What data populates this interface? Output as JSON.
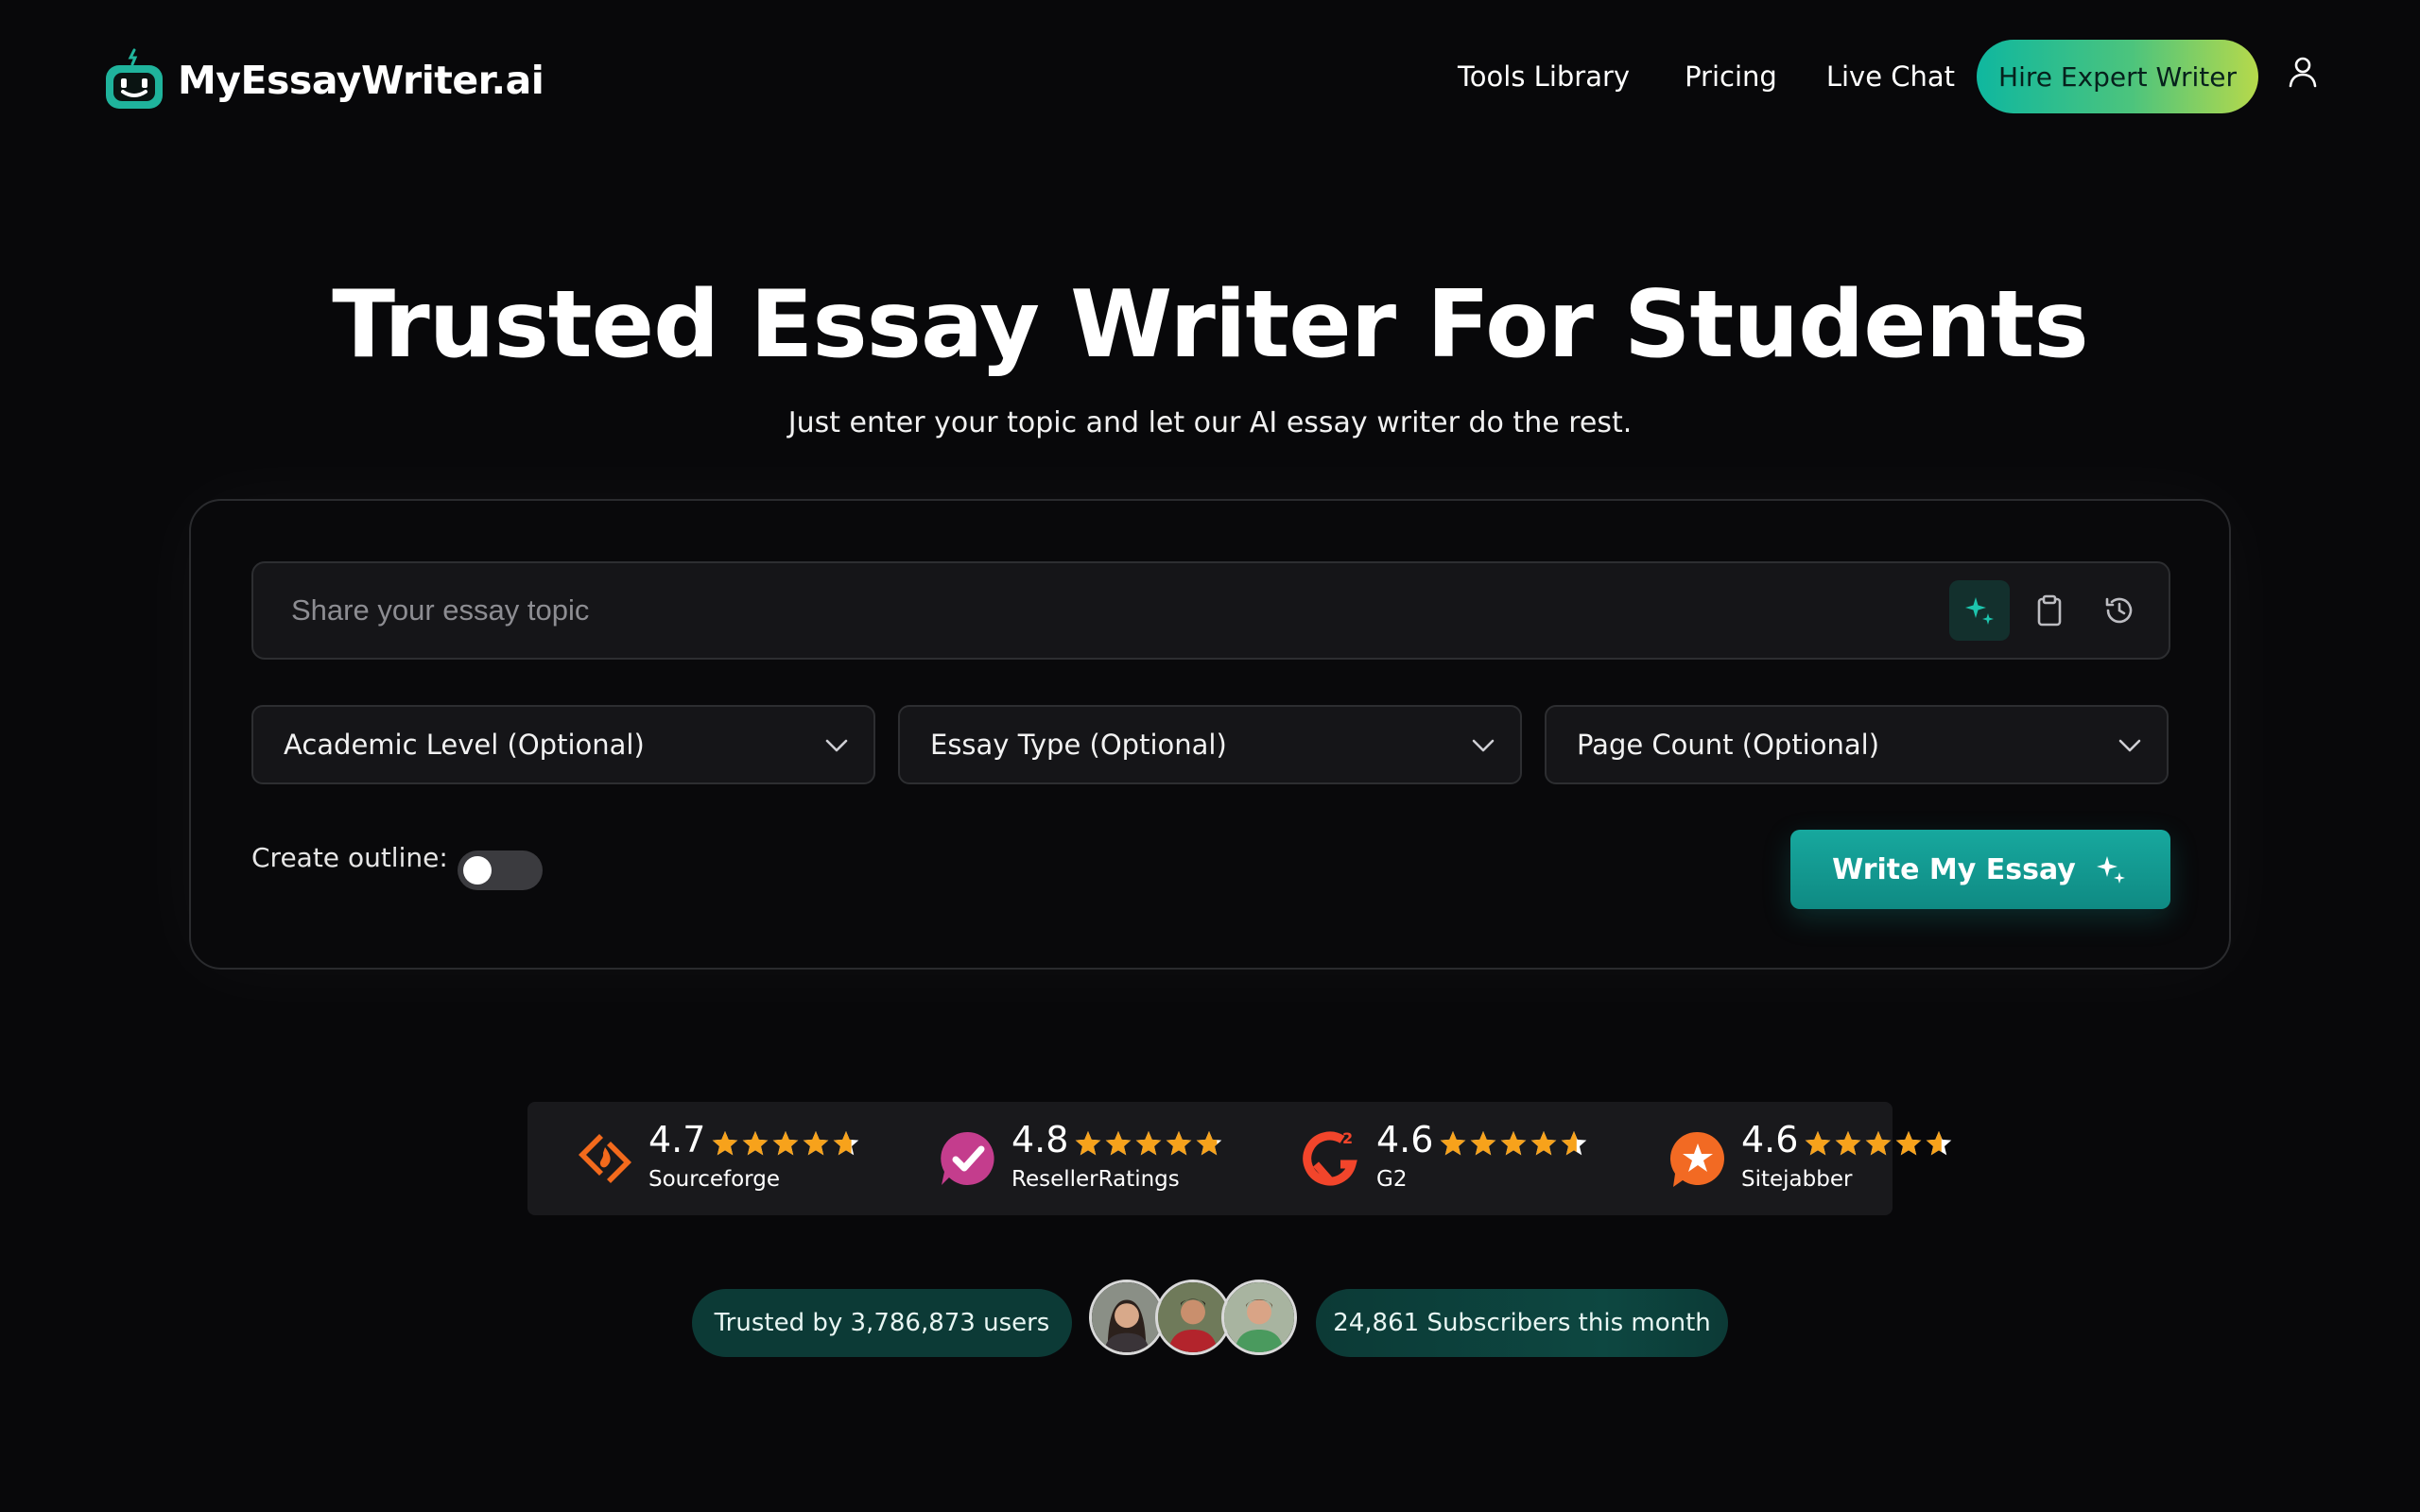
{
  "header": {
    "brand": "MyEssayWriter.ai",
    "nav": [
      "Tools Library",
      "Pricing",
      "Live Chat"
    ],
    "cta": "Hire Expert Writer"
  },
  "hero": {
    "title": "Trusted Essay Writer For Students",
    "subtitle": "Just enter your topic and let our AI essay writer do the rest."
  },
  "form": {
    "topic_placeholder": "Share your essay topic",
    "topic_value": "",
    "selects": [
      "Academic Level (Optional)",
      "Essay Type (Optional)",
      "Page Count (Optional)"
    ],
    "outline_label": "Create outline:",
    "outline_enabled": false,
    "submit": "Write My Essay"
  },
  "ratings": [
    {
      "score": "4.7",
      "name": "Sourceforge",
      "stars": 4.7,
      "color": "#f36a1c"
    },
    {
      "score": "4.8",
      "name": "ResellerRatings",
      "stars": 4.8,
      "color": "#c43d8d"
    },
    {
      "score": "4.6",
      "name": "G2",
      "stars": 4.6,
      "color": "#f2452b"
    },
    {
      "score": "4.6",
      "name": "Sitejabber",
      "stars": 4.6,
      "color": "#f26a23"
    }
  ],
  "trust": {
    "users": "Trusted by 3,786,873 users",
    "subscribers": "24,861 Subscribers this month"
  },
  "colors": {
    "accent": "#17a89e",
    "star": "#f7a21b",
    "background": "#08080a"
  }
}
